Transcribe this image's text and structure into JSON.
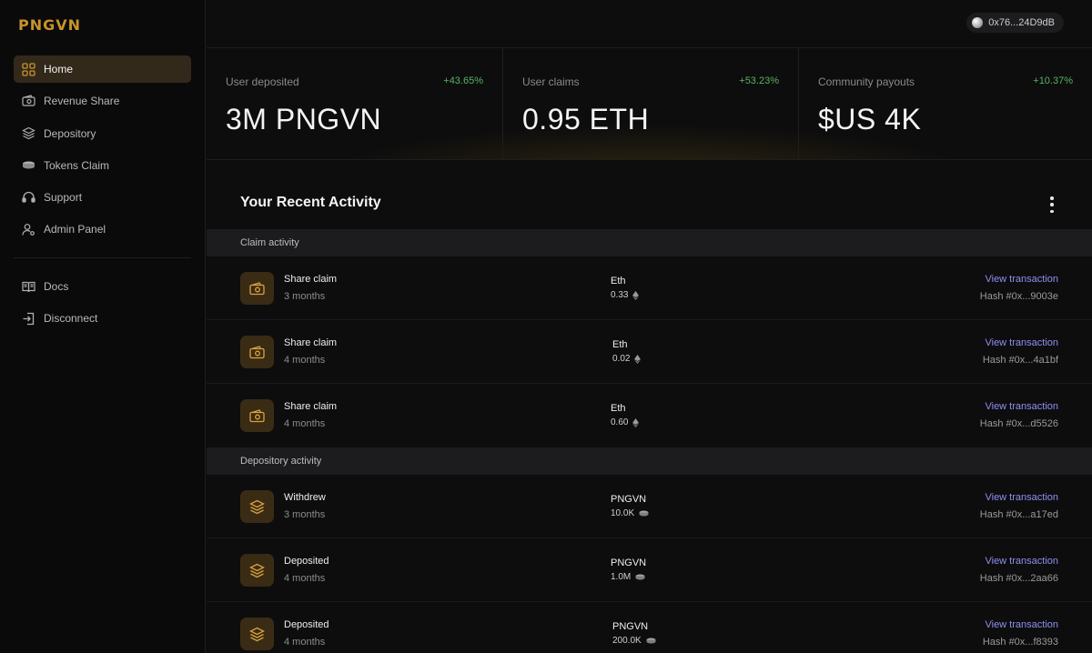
{
  "brand": {
    "logo_text": "PNGVN",
    "accent": "#c8932b"
  },
  "sidebar": {
    "items": [
      {
        "label": "Home",
        "icon": "grid-icon",
        "active": true
      },
      {
        "label": "Revenue Share",
        "icon": "wallet-icon"
      },
      {
        "label": "Depository",
        "icon": "layers-icon"
      },
      {
        "label": "Tokens Claim",
        "icon": "coins-icon"
      },
      {
        "label": "Support",
        "icon": "headset-icon"
      },
      {
        "label": "Admin Panel",
        "icon": "user-cog-icon"
      }
    ],
    "secondary": [
      {
        "label": "Docs",
        "icon": "book-icon"
      },
      {
        "label": "Disconnect",
        "icon": "logout-icon"
      }
    ]
  },
  "header": {
    "wallet_address": "0x76...24D9dB"
  },
  "stats": [
    {
      "label": "User deposited",
      "change": "+43.65%",
      "value": "3M PNGVN"
    },
    {
      "label": "User claims",
      "change": "+53.23%",
      "value": "0.95 ETH"
    },
    {
      "label": "Community payouts",
      "change": "+10.37%",
      "value": "$US 4K"
    }
  ],
  "activity": {
    "title": "Your Recent Activity",
    "claim_section": "Claim activity",
    "depository_section": "Depository activity",
    "link_label": "View transaction",
    "claims": [
      {
        "title": "Share claim",
        "time": "3 months",
        "asset": "Eth",
        "amount": "0.33",
        "hash": "Hash #0x...9003e"
      },
      {
        "title": "Share claim",
        "time": "4 months",
        "asset": "Eth",
        "amount": "0.02",
        "hash": "Hash #0x...4a1bf"
      },
      {
        "title": "Share claim",
        "time": "4 months",
        "asset": "Eth",
        "amount": "0.60",
        "hash": "Hash #0x...d5526"
      }
    ],
    "deposits": [
      {
        "title": "Withdrew",
        "time": "3 months",
        "asset": "PNGVN",
        "amount": "10.0K",
        "hash": "Hash #0x...a17ed"
      },
      {
        "title": "Deposited",
        "time": "4 months",
        "asset": "PNGVN",
        "amount": "1.0M",
        "hash": "Hash #0x...2aa66"
      },
      {
        "title": "Deposited",
        "time": "4 months",
        "asset": "PNGVN",
        "amount": "200.0K",
        "hash": "Hash #0x...f8393"
      }
    ]
  }
}
